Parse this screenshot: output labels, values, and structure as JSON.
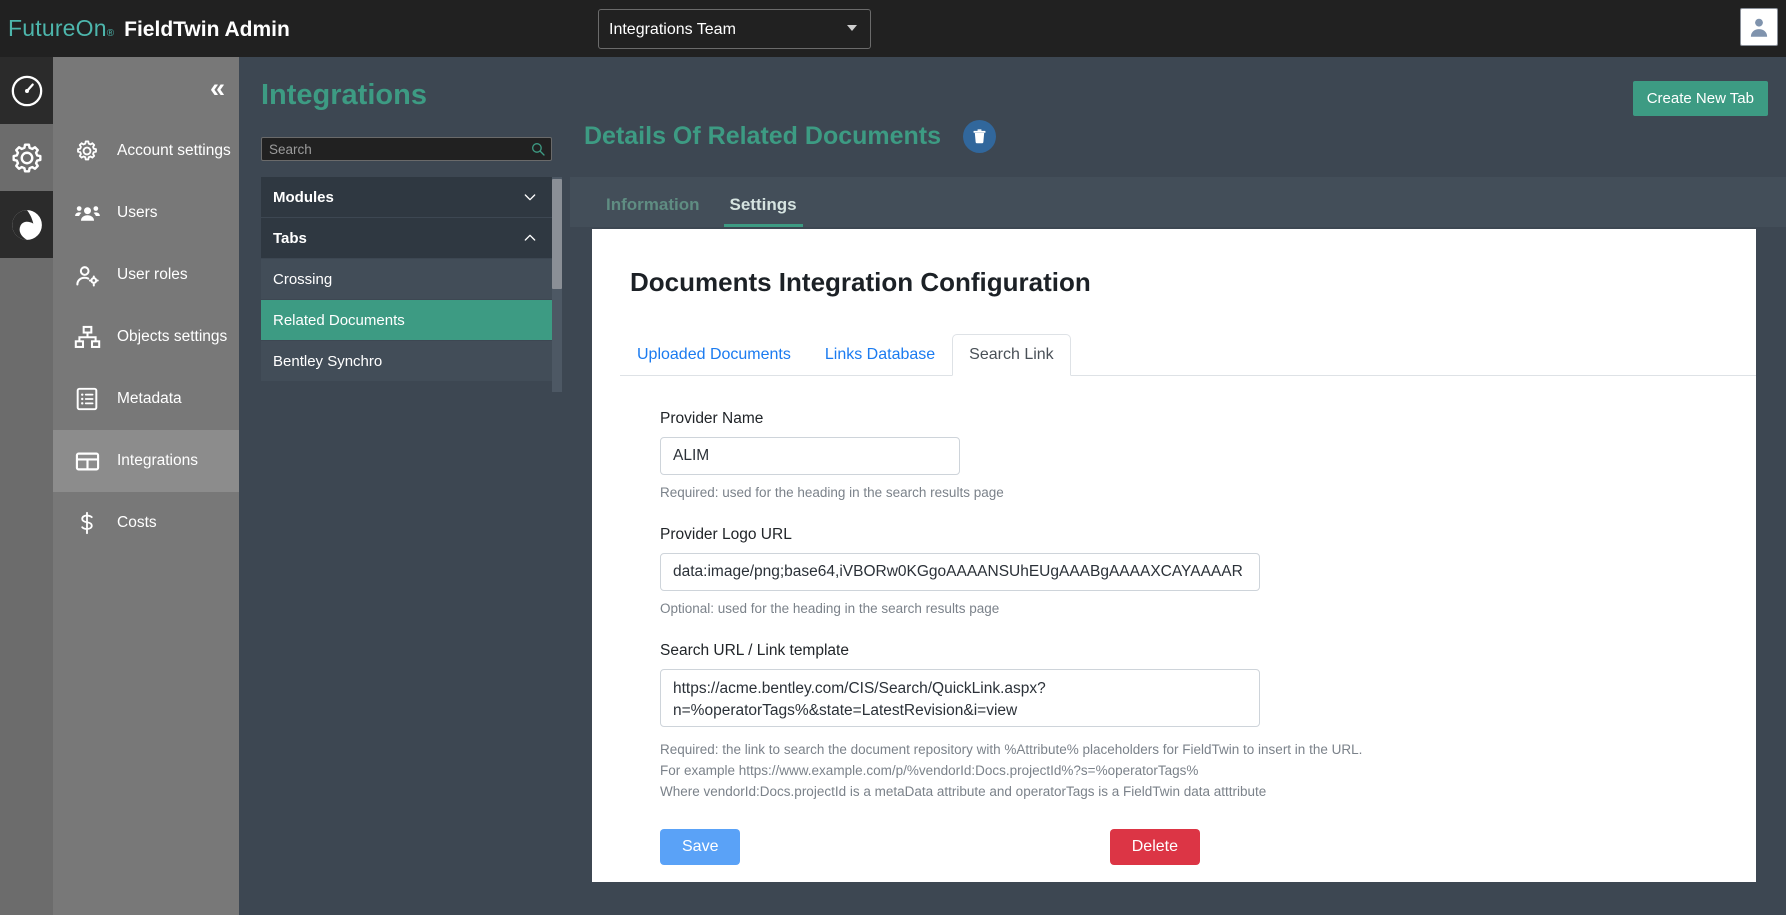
{
  "header": {
    "brand_name": "FutureOn",
    "brand_reg": "®",
    "app_title": "FieldTwin Admin",
    "team_select_value": "Integrations Team",
    "team_select_options": [
      "Integrations Team"
    ],
    "avatar_icon": "user-avatar-icon"
  },
  "rail": {
    "items": [
      {
        "icon": "speedometer-icon",
        "name": "dashboard"
      },
      {
        "icon": "gear-icon",
        "name": "settings"
      },
      {
        "icon": "globe-logo-icon",
        "name": "fieldtwin-logo"
      }
    ]
  },
  "sidebar": {
    "collapse_icon": "«",
    "items": [
      {
        "label": "Account settings",
        "icon": "gear-icon"
      },
      {
        "label": "Users",
        "icon": "users-icon"
      },
      {
        "label": "User roles",
        "icon": "user-roles-icon"
      },
      {
        "label": "Objects settings",
        "icon": "sitemap-icon"
      },
      {
        "label": "Metadata",
        "icon": "list-details-icon"
      },
      {
        "label": "Integrations",
        "icon": "table-grid-icon",
        "active": true
      },
      {
        "label": "Costs",
        "icon": "dollar-icon"
      }
    ]
  },
  "list_panel": {
    "page_title": "Integrations",
    "search_placeholder": "Search",
    "search_value": "",
    "search_icon": "magnifier-icon",
    "tree": [
      {
        "type": "group",
        "label": "Modules",
        "expanded": false,
        "chevron": "chevron-down-icon"
      },
      {
        "type": "group",
        "label": "Tabs",
        "expanded": true,
        "chevron": "chevron-up-icon"
      },
      {
        "type": "leaf",
        "label": "Crossing",
        "selected": false
      },
      {
        "type": "leaf",
        "label": "Related Documents",
        "selected": true
      },
      {
        "type": "leaf",
        "label": "Bentley Synchro",
        "selected": false
      }
    ]
  },
  "content": {
    "create_tab_label": "Create New Tab",
    "detail_title": "Details Of Related Documents",
    "delete_tab_icon": "trash-icon",
    "subtabs": [
      {
        "label": "Information",
        "active": false
      },
      {
        "label": "Settings",
        "active": true
      }
    ]
  },
  "card": {
    "title": "Documents Integration Configuration",
    "tabs": [
      {
        "label": "Uploaded Documents",
        "active": false
      },
      {
        "label": "Links Database",
        "active": false
      },
      {
        "label": "Search Link",
        "active": true
      }
    ],
    "fields": [
      {
        "label": "Provider Name",
        "value": "ALIM",
        "help": [
          "Required: used for the heading in the search results page"
        ]
      },
      {
        "label": "Provider Logo URL",
        "value": "data:image/png;base64,iVBORw0KGgoAAAANSUhEUgAAABgAAAAXCAYAAAAR",
        "help": [
          "Optional: used for the heading in the search results page"
        ]
      },
      {
        "label": "Search URL / Link template",
        "value": "https://acme.bentley.com/CIS/Search/QuickLink.aspx?n=%operatorTags%&state=LatestRevision&i=view",
        "help": [
          "Required: the link to search the document repository with %Attribute% placeholders for FieldTwin to insert in the URL.",
          "For example https://www.example.com/p/%vendorId:Docs.projectId%?s=%operatorTags%",
          "Where vendorId:Docs.projectId is a metaData attribute and operatorTags is a FieldTwin data atttribute"
        ]
      }
    ],
    "save_label": "Save",
    "delete_label": "Delete"
  },
  "colors": {
    "brand_teal": "#3d9b83",
    "accent_blue": "#1b7bf0",
    "save_blue": "#5aa2f7",
    "delete_red": "#dc3545",
    "topbar": "#212121",
    "page_bg": "#3d4752"
  }
}
